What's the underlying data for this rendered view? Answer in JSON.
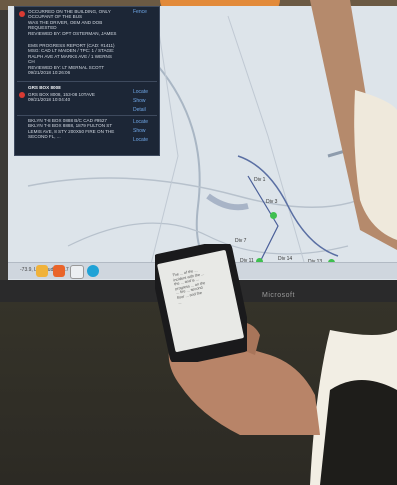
{
  "panel": {
    "top_lines": "OCCURRED ON THE BUILDING, ONLY OCCUPANT OF THE BUS\nWAS THE DRIVER, OEM AND DOB\nREQUESTED\nREVIEWED BY: DPT OSTERMAN, JAMES",
    "progress_lines": "EMS PROGRESS REPORT (CAD: #1411)\nMSG: CAD LT MAIDEN / TPC: 1 / STAGE:\nRALPH AVE AT MARKS AVE / 1 WERNS\nCH\nREVIEWED BY: LT MERNAL SCOTT\n09/21/2018 10:26:06",
    "box1_title": "GRS BOX 8008",
    "box1_lines": "GRS BOX 8008, 153-08 10TAVE\n09/21/2018 10:04:40",
    "box2_lines": "BKLYN T-8 BOX 0888 B/C CAD #9527\nBKLYN T-8 BOX 8888, 1879 FULTON ST\nLEMIS AVE, 8 STY 200X50 FIRE ON THE\nSECOND FL, ...",
    "links": [
      "Fence",
      "Locate",
      "Show",
      "Detail",
      "Locate",
      "Show",
      "Locate"
    ]
  },
  "taskbar": {
    "coords": "-73.9, Longitude: 40.7"
  },
  "map_labels": [
    "Div 1",
    "Div 3",
    "Div 7",
    "Div 11",
    "Div 13",
    "Div 14"
  ],
  "brand": "Microsoft",
  "phone": {
    "text": "The ... of the ...\nincident with the ...\nthe ... and is ...\nprogress ... on the\n... fire ... second\nfloor ... and the\n..."
  },
  "colors": {
    "panel_bg": "#1c2636",
    "map_bg": "#dfe6ec",
    "marker_green": "#3fbf4f",
    "marker_red": "#d93b33"
  }
}
